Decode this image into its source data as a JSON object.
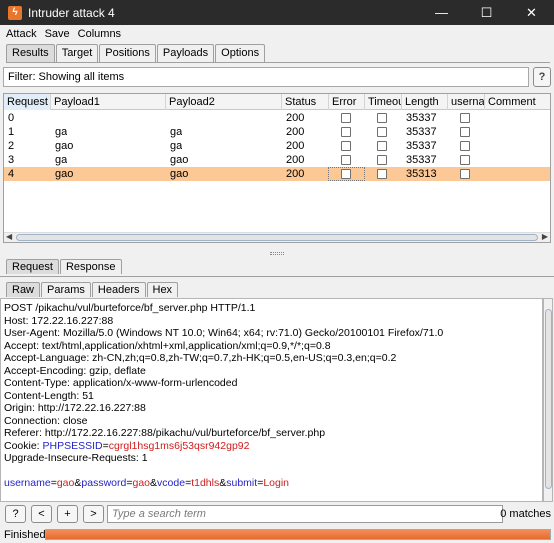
{
  "window": {
    "title": "Intruder attack 4",
    "icon": "burp-logo-icon",
    "controls": [
      "minimize-icon",
      "maximize-icon",
      "close-icon"
    ]
  },
  "menu": [
    "Attack",
    "Save",
    "Columns"
  ],
  "main_tabs": [
    {
      "label": "Results",
      "active": true
    },
    {
      "label": "Target",
      "active": false
    },
    {
      "label": "Positions",
      "active": false
    },
    {
      "label": "Payloads",
      "active": false
    },
    {
      "label": "Options",
      "active": false
    }
  ],
  "filter": {
    "text": "Filter: Showing all items",
    "help_label": "?"
  },
  "table": {
    "columns": [
      "Request",
      "Payload1",
      "Payload2",
      "Status",
      "Error",
      "Timeout",
      "Length",
      "userna...",
      "Comment"
    ],
    "sort_indicator": "▲",
    "rows": [
      {
        "request": "0",
        "payload1": "",
        "payload2": "",
        "status": "200",
        "length": "35337",
        "selected": false
      },
      {
        "request": "1",
        "payload1": "ga",
        "payload2": "ga",
        "status": "200",
        "length": "35337",
        "selected": false
      },
      {
        "request": "2",
        "payload1": "gao",
        "payload2": "ga",
        "status": "200",
        "length": "35337",
        "selected": false
      },
      {
        "request": "3",
        "payload1": "ga",
        "payload2": "gao",
        "status": "200",
        "length": "35337",
        "selected": false
      },
      {
        "request": "4",
        "payload1": "gao",
        "payload2": "gao",
        "status": "200",
        "length": "35313",
        "selected": true
      }
    ]
  },
  "detail_tabs": [
    {
      "label": "Request",
      "active": true
    },
    {
      "label": "Response",
      "active": false
    }
  ],
  "view_tabs": [
    {
      "label": "Raw",
      "active": true
    },
    {
      "label": "Params",
      "active": false
    },
    {
      "label": "Headers",
      "active": false
    },
    {
      "label": "Hex",
      "active": false
    }
  ],
  "request_lines": [
    "POST /pikachu/vul/burteforce/bf_server.php HTTP/1.1",
    "Host: 172.22.16.227:88",
    "User-Agent: Mozilla/5.0 (Windows NT 10.0; Win64; x64; rv:71.0) Gecko/20100101 Firefox/71.0",
    "Accept: text/html,application/xhtml+xml,application/xml;q=0.9,*/*;q=0.8",
    "Accept-Language: zh-CN,zh;q=0.8,zh-TW;q=0.7,zh-HK;q=0.5,en-US;q=0.3,en;q=0.2",
    "Accept-Encoding: gzip, deflate",
    "Content-Type: application/x-www-form-urlencoded",
    "Content-Length: 51",
    "Origin: http://172.22.16.227:88",
    "Connection: close",
    "Referer: http://172.22.16.227:88/pikachu/vul/burteforce/bf_server.php"
  ],
  "cookie": {
    "label": "Cookie: ",
    "name": "PHPSESSID",
    "eq": "=",
    "value": "cgrgl1hsg1ms6j53qsr942gp92"
  },
  "upgrade_line": "Upgrade-Insecure-Requests: 1",
  "body_params": {
    "p1_name": "username",
    "p1_value": "gao",
    "p2_name": "password",
    "p2_value": "gao",
    "p3_name": "vcode",
    "p3_value": "t1dhls",
    "p4_name": "submit",
    "p4_value": "Login",
    "eq": "=",
    "amp": "&"
  },
  "bottom": {
    "help_label": "?",
    "prev_label": "<",
    "add_label": "+",
    "next_label": ">",
    "search_placeholder": "Type a search term",
    "matches": "0 matches"
  },
  "status": {
    "label": "Finished",
    "progress": 1.0
  },
  "colors": {
    "selected_row": "#fcc896",
    "progress": "#e86a2e",
    "param_name": "#2424c8",
    "param_value": "#d01c1c"
  }
}
